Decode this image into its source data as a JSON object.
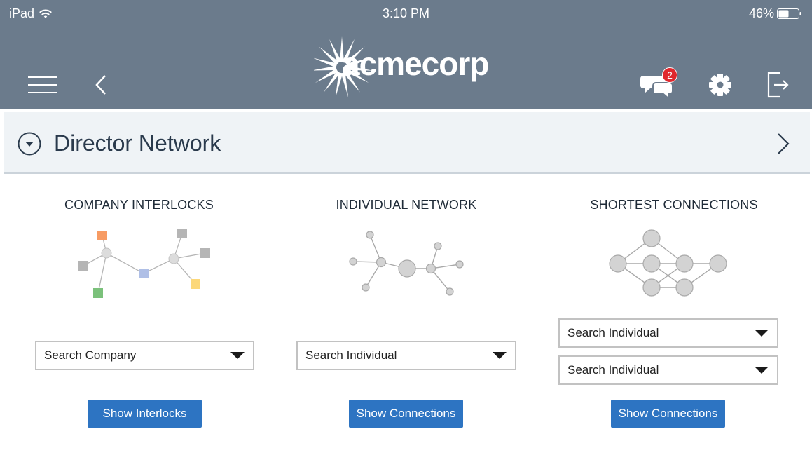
{
  "status_bar": {
    "device": "iPad",
    "time": "3:10 PM",
    "battery": "46%"
  },
  "header": {
    "logo_text": "acmecorp",
    "messages_badge": "2",
    "icons": {
      "menu": "hamburger-icon",
      "back": "chevron-left-icon",
      "messages": "chat-bubbles-icon",
      "settings": "gear-icon",
      "logout": "logout-icon"
    }
  },
  "section": {
    "title": "Director Network",
    "icons": {
      "collapse": "circle-chevron-down-icon",
      "next": "chevron-right-icon"
    }
  },
  "panels": [
    {
      "title": "COMPANY INTERLOCKS",
      "selects": [
        "Search Company"
      ],
      "button": "Show Interlocks"
    },
    {
      "title": "INDIVIDUAL NETWORK",
      "selects": [
        "Search Individual"
      ],
      "button": "Show Connections"
    },
    {
      "title": "SHORTEST CONNECTIONS",
      "selects": [
        "Search Individual",
        "Search Individual"
      ],
      "button": "Show Connections"
    }
  ],
  "colors": {
    "topbar": "#6b7b8c",
    "button": "#2d74c2",
    "badge": "#e0282e"
  }
}
